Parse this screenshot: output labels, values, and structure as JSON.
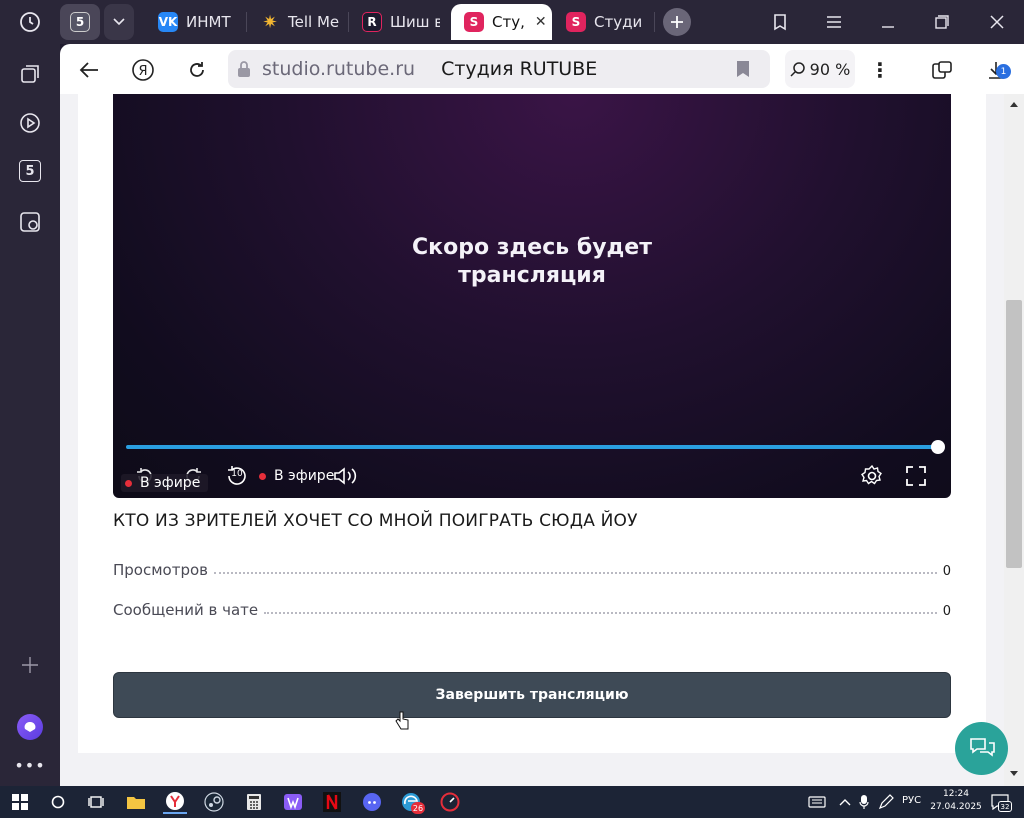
{
  "browser": {
    "tabs": [
      {
        "label": "5",
        "icon": "number-5-icon",
        "color": "#555566"
      },
      {
        "label": "ИНМТ",
        "icon": "vk-icon",
        "color": "#2787f5"
      },
      {
        "label": "Tell Me",
        "icon": "sun-icon",
        "color": "#f2b632"
      },
      {
        "label": "Шиш в",
        "icon": "r-logo-icon",
        "color": "#1b1b2e"
      },
      {
        "label": "Сту,",
        "icon": "rutube-studio-icon",
        "color": "#e0245e"
      },
      {
        "label": "Студи",
        "icon": "rutube-studio-icon",
        "color": "#e0245e"
      }
    ],
    "url_host": "studio.rutube.ru",
    "page_title": "Студия RUTUBE",
    "zoom": "90 %",
    "downloads_badge": "1"
  },
  "player": {
    "message_line1": "Скоро здесь будет",
    "message_line2": "трансляция",
    "live_label_small": "В эфире",
    "live_label": "В эфире",
    "replay_seconds": "10"
  },
  "stream": {
    "title": "КТО ИЗ ЗРИТЕЛЕЙ ХОЧЕТ СО МНОЙ ПОИГРАТЬ СЮДА ЙОУ",
    "stats": [
      {
        "label": "Просмотров",
        "value": "0"
      },
      {
        "label": "Сообщений в чате",
        "value": "0"
      }
    ],
    "end_button": "Завершить трансляцию"
  },
  "taskbar": {
    "lang": "РУС",
    "time": "12:24",
    "date": "27.04.2025",
    "notif_badge": "32",
    "edge_badge": "26"
  },
  "colors": {
    "accent_progress": "#2a9fe0",
    "live_dot": "#e52e3a",
    "end_button_bg": "#3e4a56",
    "help_button_bg": "#2aa39a"
  }
}
